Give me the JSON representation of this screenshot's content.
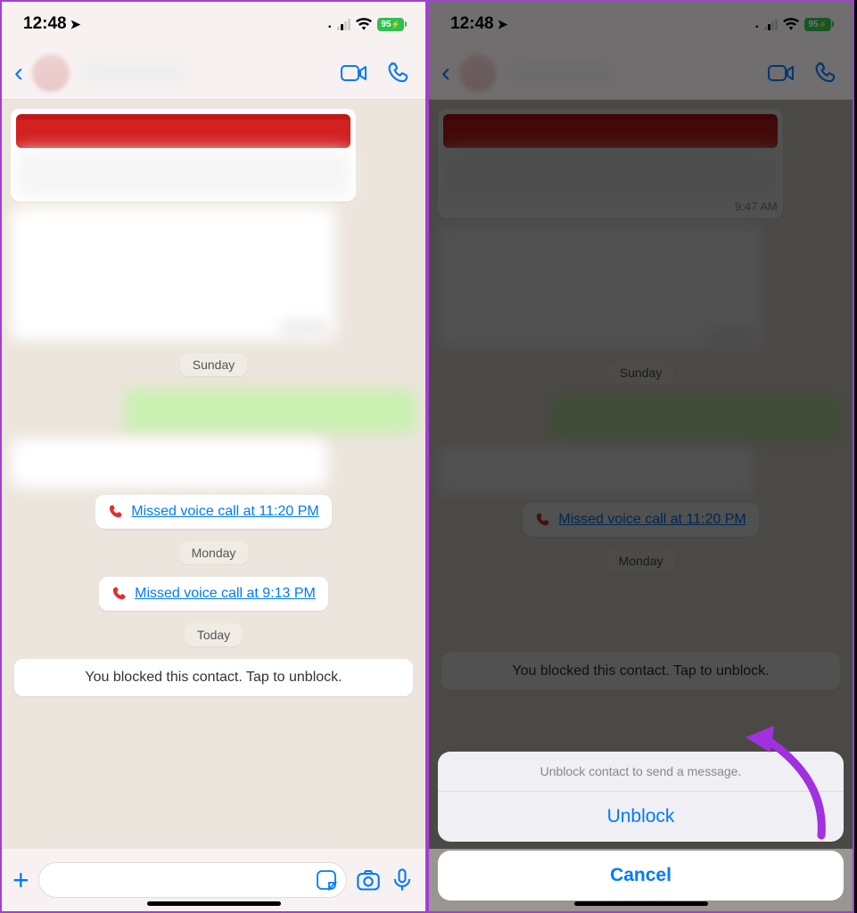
{
  "status": {
    "time": "12:48",
    "battery": "95"
  },
  "nav": {
    "video_icon": "video-icon",
    "call_icon": "phone-icon",
    "back_icon": "chevron-left-icon"
  },
  "chat": {
    "msg1_time": "9:47 AM",
    "msg2_time": "6:03 PM",
    "date1": "Sunday",
    "date2": "Monday",
    "date3": "Today",
    "call1": "Missed voice call at 11:20 PM",
    "call2": "Missed voice call at 9:13 PM",
    "blocked_text": "You blocked this contact. Tap to unblock."
  },
  "sheet": {
    "title": "Unblock contact to send a message.",
    "unblock": "Unblock",
    "cancel": "Cancel"
  }
}
